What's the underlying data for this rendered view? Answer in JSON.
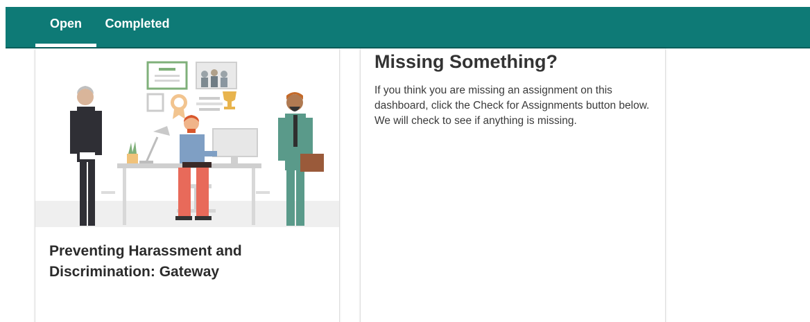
{
  "colors": {
    "accent": "#0e7a76"
  },
  "tabs": [
    {
      "label": "Open",
      "selected": true
    },
    {
      "label": "Completed",
      "selected": false
    }
  ],
  "course_card": {
    "title": "Preventing Harassment and Discrimination: Gateway",
    "image_icon": "office-illustration"
  },
  "missing_card": {
    "title": "Missing Something?",
    "body": "If you think you are missing an assignment on this dashboard, click the Check for Assignments button below. We will check to see if anything is missing."
  }
}
